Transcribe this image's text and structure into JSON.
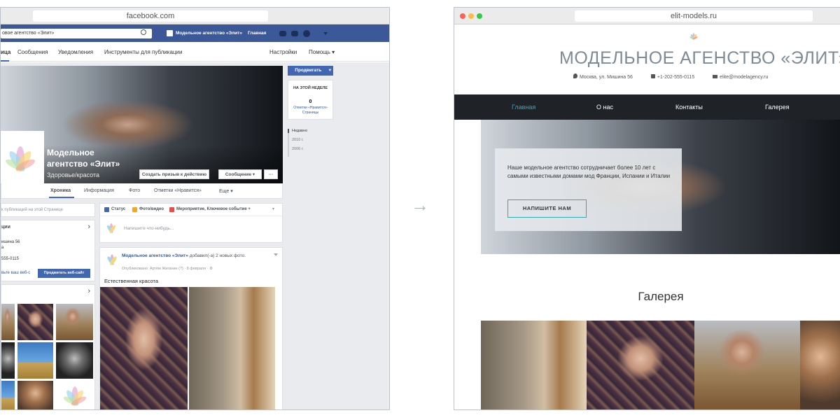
{
  "facebook": {
    "url": "facebook.com",
    "search_value": "овое агентство «Элит»",
    "top_page_name": "Модельное агентство «Элит»",
    "top_home": "Главная",
    "tabs": [
      "ица",
      "Сообщения",
      "Уведомления",
      "Инструменты для публикации"
    ],
    "tab_settings": "Настройки",
    "tab_help": "Помощь ▾",
    "promote": "Продвигать",
    "promote_arrow": "▾",
    "this_week": "НА ЭТОЙ НЕДЕЛЕ",
    "likes_count": "0",
    "likes_label": "Отметки «Нравится» Страницы",
    "timeline": [
      "Недавно",
      "2010 г.",
      "2006 г."
    ],
    "page_name": "Модельное агентство «Элит»",
    "category": "Здоровье/красота",
    "cta_button": "Создать призыв к действию",
    "message_button": "Сообщение ▾",
    "more_button": "···",
    "page_tabs": [
      "Хроника",
      "Информация",
      "Фото",
      "Отметки «Нравится»",
      "Еще ▾"
    ],
    "search_posts": "к публикаций на этой Странице",
    "about_header": "ции",
    "address": "ишина 56",
    "city": "а",
    "phone": "555-0115",
    "website_link": "вьте ваш веб-с",
    "create_site": "Продвигать веб-сайт",
    "chevron": "›",
    "composer_tabs": [
      "Статус",
      "Фото/видео",
      "Мероприятие, Ключевое событие +"
    ],
    "composer_arrow": "▾",
    "composer_placeholder": "Напишите что-нибудь...",
    "post_author": "Модельное агентство «Элит»",
    "post_action": "добавил(-а) 2 новых фото.",
    "post_meta": "Опубликовано: Артём Жиганин (?) · 8 февраля · ⚙",
    "post_text": "Естественная красота"
  },
  "arrow": "→",
  "site": {
    "url": "elit-models.ru",
    "title": "МОДЕЛЬНОЕ АГЕНСТВО «ЭЛИТ»",
    "address": "Москва, ул. Мишина 56",
    "phone": "+1-202-555-0115",
    "email": "elite@modelagency.ru",
    "nav": [
      "Главная",
      "О нас",
      "Контакты",
      "Галерея"
    ],
    "hero_text": "Наше модельное агентство сотрудничает более 10 лет с самыми известными домами мод Франции, Испании и Италии",
    "hero_button": "НАПИШИТЕ НАМ",
    "gallery_title": "Галерея"
  },
  "colors": {
    "fb_blue": "#3b5998",
    "nav_dark": "#1f2327",
    "accent": "#3ba5b8"
  }
}
